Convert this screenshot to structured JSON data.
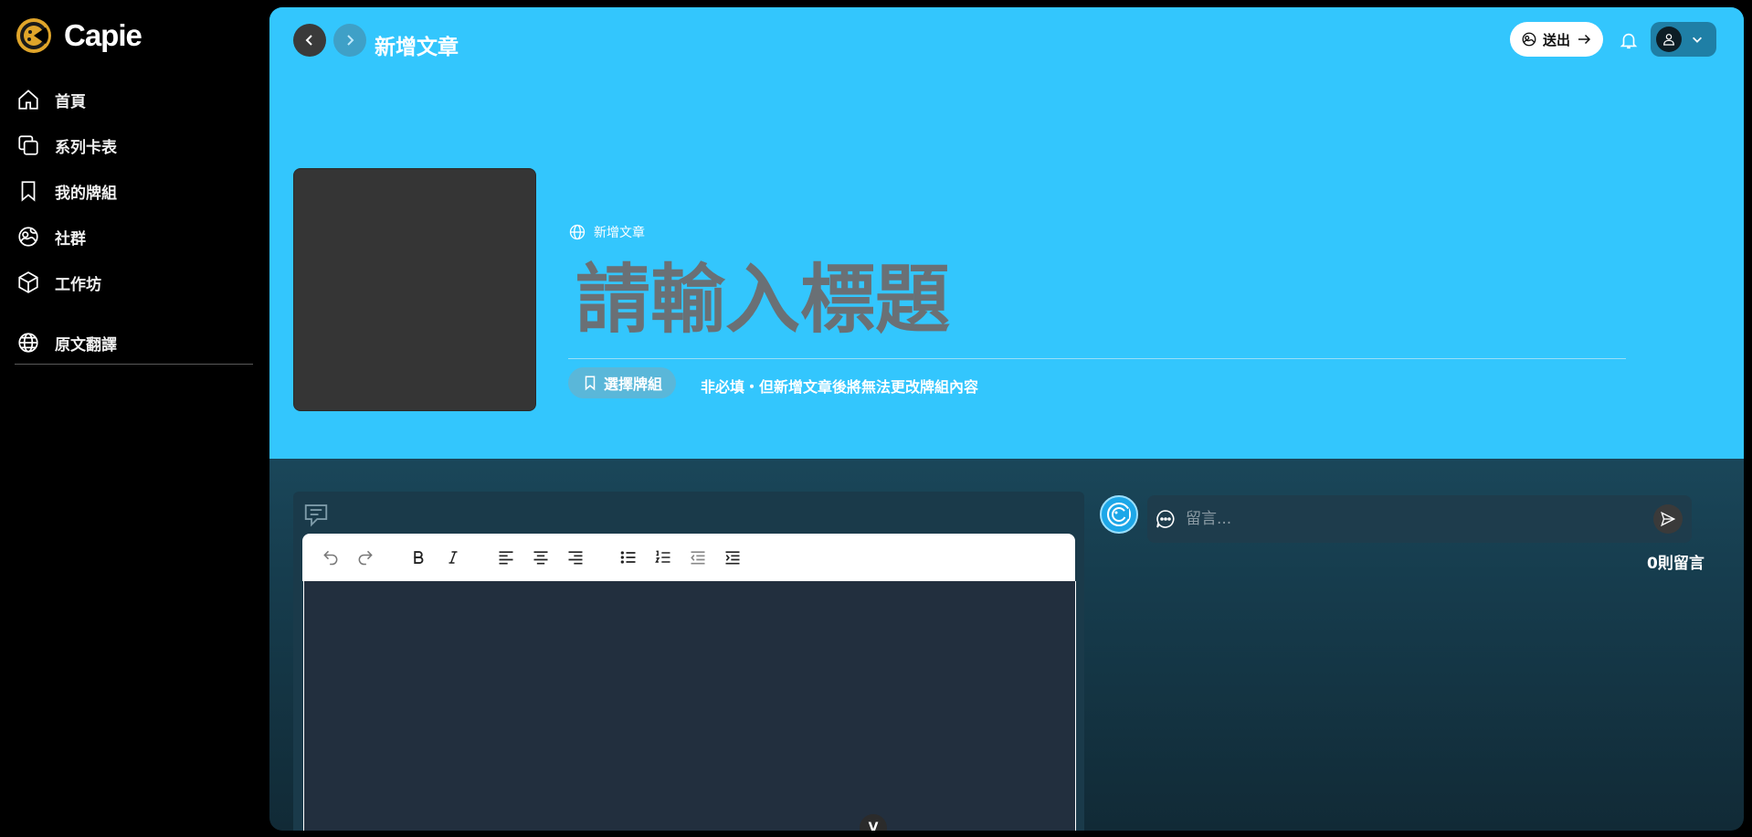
{
  "brand": {
    "name": "Capie"
  },
  "sidebar": {
    "items": [
      {
        "label": "首頁",
        "icon": "home-icon"
      },
      {
        "label": "系列卡表",
        "icon": "copy-cards-icon"
      },
      {
        "label": "我的牌組",
        "icon": "bookmark-icon"
      },
      {
        "label": "社群",
        "icon": "community-icon"
      },
      {
        "label": "工作坊",
        "icon": "box-icon"
      },
      {
        "label": "原文翻譯",
        "icon": "globe-icon"
      }
    ]
  },
  "header": {
    "title": "新增文章",
    "send_label": "送出"
  },
  "article": {
    "breadcrumb": "新增文章",
    "title_placeholder": "請輸入標題",
    "deck_button": "選擇牌組",
    "deck_note": "非必填・但新增文章後將無法更改牌組內容"
  },
  "editor": {
    "scroll_label": "V"
  },
  "comments": {
    "placeholder": "留言...",
    "count_label": "0則留言"
  },
  "colors": {
    "hero_bg": "#33c6fd",
    "sidebar_bg": "#000000",
    "editor_bg": "#222f3e"
  }
}
